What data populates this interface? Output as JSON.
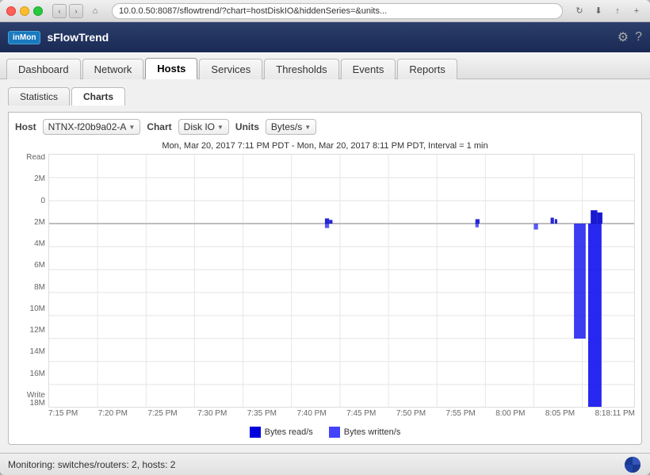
{
  "browser": {
    "address": "10.0.0.50:8087/sflowtrend/?chart=hostDiskIO&hiddenSeries=&units...",
    "back_label": "‹",
    "forward_label": "›"
  },
  "app": {
    "logo": "inMon",
    "title": "sFlowTrend",
    "settings_icon": "⚙",
    "help_icon": "?"
  },
  "nav": {
    "tabs": [
      {
        "label": "Dashboard",
        "active": false
      },
      {
        "label": "Network",
        "active": false
      },
      {
        "label": "Hosts",
        "active": true
      },
      {
        "label": "Services",
        "active": false
      },
      {
        "label": "Thresholds",
        "active": false
      },
      {
        "label": "Events",
        "active": false
      },
      {
        "label": "Reports",
        "active": false
      }
    ]
  },
  "sub_nav": {
    "tabs": [
      {
        "label": "Statistics",
        "active": false
      },
      {
        "label": "Charts",
        "active": true
      }
    ]
  },
  "chart_controls": {
    "host_label": "Host",
    "host_value": "NTNX-f20b9a02-A",
    "chart_label": "Chart",
    "chart_value": "Disk IO",
    "units_label": "Units",
    "units_value": "Bytes/s"
  },
  "chart": {
    "title": "Mon, Mar 20, 2017 7:11 PM PDT - Mon, Mar 20, 2017 8:11 PM PDT, Interval = 1 min",
    "y_labels_read": [
      "Read",
      "2M",
      "0"
    ],
    "y_labels_write": [
      "2M",
      "4M",
      "6M",
      "8M",
      "10M",
      "12M",
      "14M",
      "16M",
      "Write\n18M"
    ],
    "x_labels": [
      "7:15 PM",
      "7:20 PM",
      "7:25 PM",
      "7:30 PM",
      "7:35 PM",
      "7:40 PM",
      "7:45 PM",
      "7:50 PM",
      "7:55 PM",
      "8:00 PM",
      "8:05 PM",
      "8:18:11 PM"
    ],
    "legend": [
      {
        "label": "Bytes read/s",
        "color": "#0000dd"
      },
      {
        "label": "Bytes written/s",
        "color": "#4444ff"
      }
    ]
  },
  "status_bar": {
    "text": "Monitoring: switches/routers: 2, hosts: 2"
  }
}
